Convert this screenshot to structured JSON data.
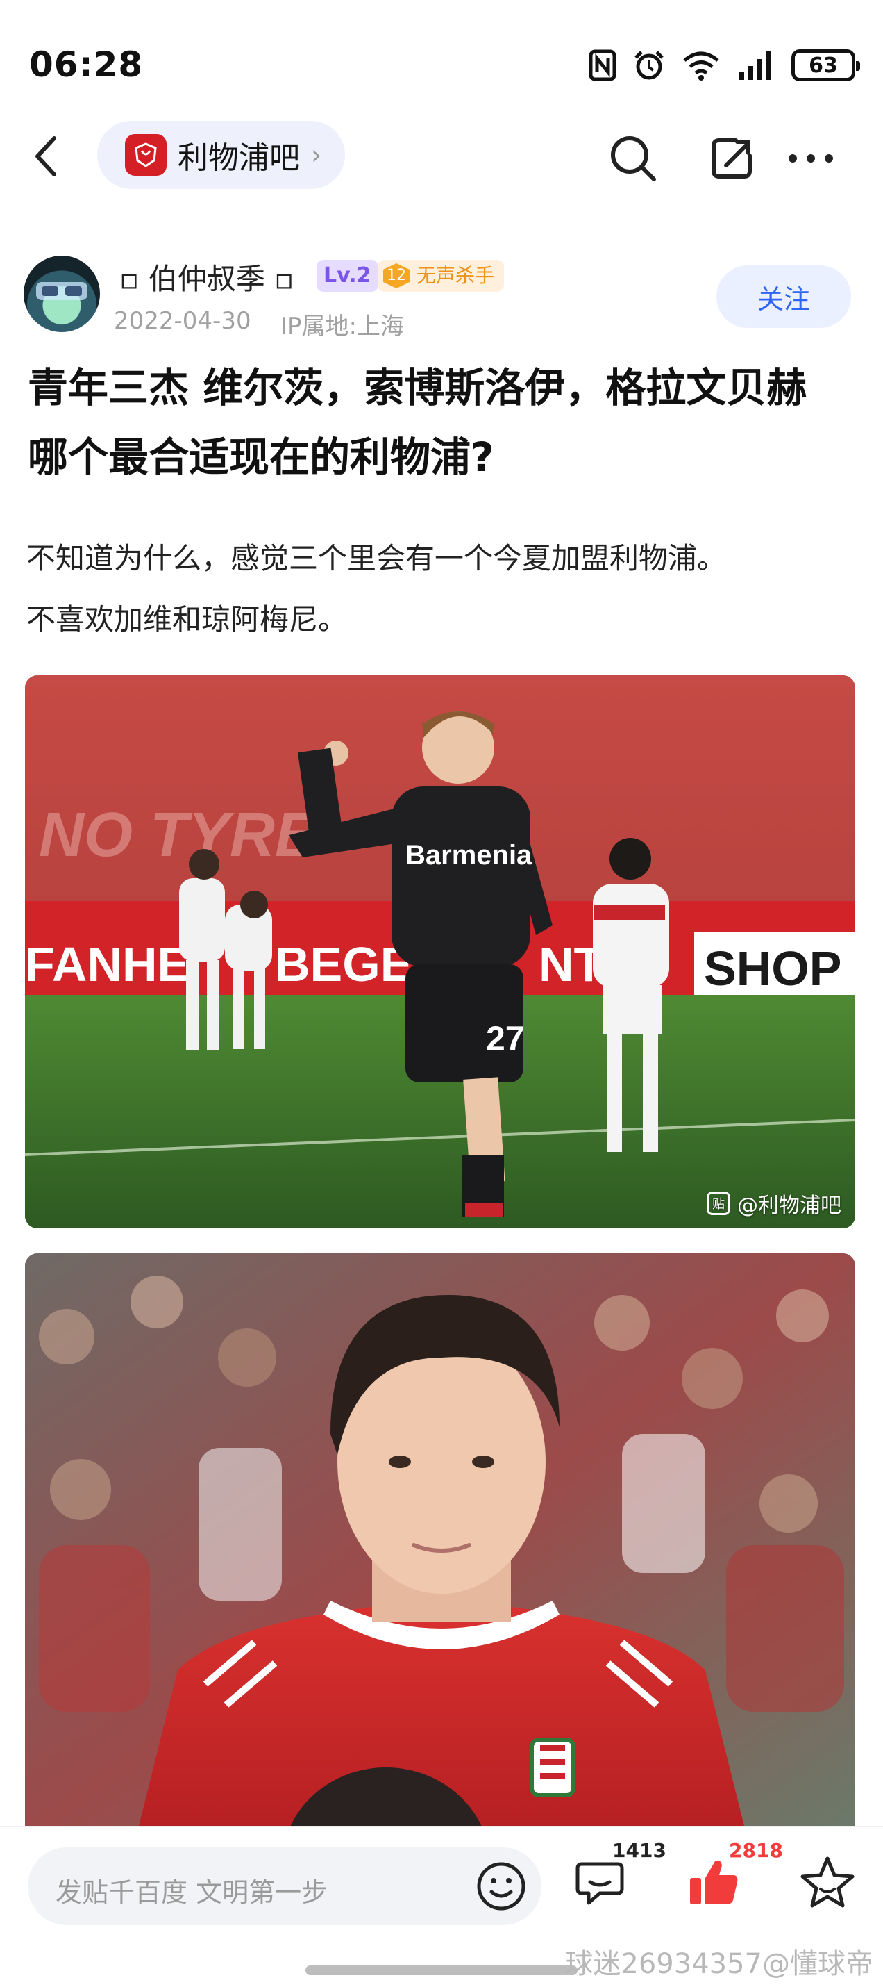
{
  "status_bar": {
    "time": "06:28",
    "icons": [
      "nfc-icon",
      "alarm-icon",
      "wifi-icon",
      "signal-icon",
      "battery-icon"
    ],
    "battery": "63"
  },
  "nav": {
    "back_icon": "chevron-left-icon",
    "forum_name": "利物浦吧",
    "forum_chevron": "›",
    "icons": [
      "search-icon",
      "share-icon",
      "more-icon"
    ]
  },
  "author": {
    "name": "▫ 伯仲叔季 ▫",
    "level": "Lv.2",
    "title_level": "12",
    "title": "无声杀手",
    "date": "2022-04-30",
    "ip": "IP属地:上海",
    "follow_label": "关注"
  },
  "post": {
    "title": "青年三杰  维尔茨，索博斯洛伊，格拉文贝赫  哪个最合适现在的利物浦?",
    "body_line1": "不知道为什么，感觉三个里会有一个今夏加盟利物浦。",
    "body_line2": "不喜欢加维和琼阿梅尼。",
    "image1_watermark": "@利物浦吧",
    "image1_jersey_sponsor": "Barmenia",
    "image1_jersey_number": "27",
    "image1_board_text1": "FANHE",
    "image1_board_text2": "BEGEH",
    "image1_board_text3": "NT",
    "image1_board_text4": "SHOP",
    "image1_board_text5": "NO TYRE"
  },
  "bottom_bar": {
    "reply_placeholder": "发贴千百度 文明第一步",
    "comment_count": "1413",
    "like_count": "2818",
    "colors": {
      "like": "#f23b3b"
    }
  },
  "footer_watermark": "球迷26934357@懂球帝"
}
